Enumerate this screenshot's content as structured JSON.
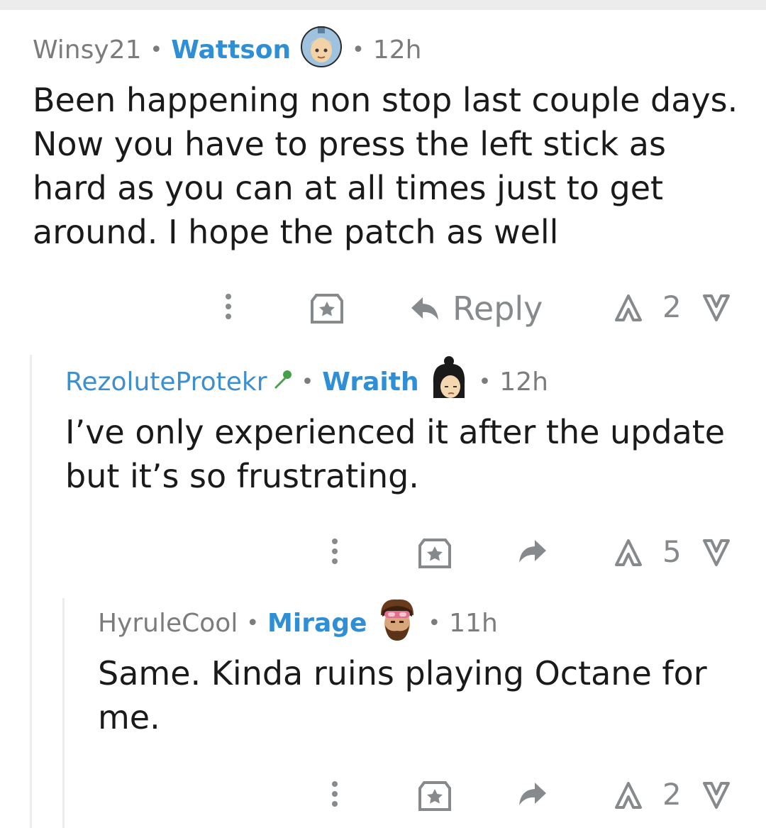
{
  "comments": [
    {
      "author": "Winsy21",
      "flair": "Wattson",
      "avatar_icon": "wattson-avatar-icon",
      "time": "12h",
      "body": "Been happening non stop last couple days. Now you have to press the left stick as hard as you can at all times just to get around. I hope the patch as well",
      "reply_label": "Reply",
      "score": "2"
    },
    {
      "author": "RezoluteProtekr",
      "flair": "Wraith",
      "avatar_icon": "wraith-avatar-icon",
      "time": "12h",
      "body": "I’ve only experienced it after the update but it’s so frustrating.",
      "score": "5"
    },
    {
      "author": "HyruleCool",
      "flair": "Mirage",
      "avatar_icon": "mirage-avatar-icon",
      "time": "11h",
      "body": "Same. Kinda ruins playing Octane for me.",
      "score": "2"
    }
  ],
  "colors": {
    "flair": "#2e8fd6",
    "author_op": "#3d8fd0",
    "meta": "#7c7c7c",
    "action": "#878a8c",
    "mod_green": "#46a049"
  }
}
